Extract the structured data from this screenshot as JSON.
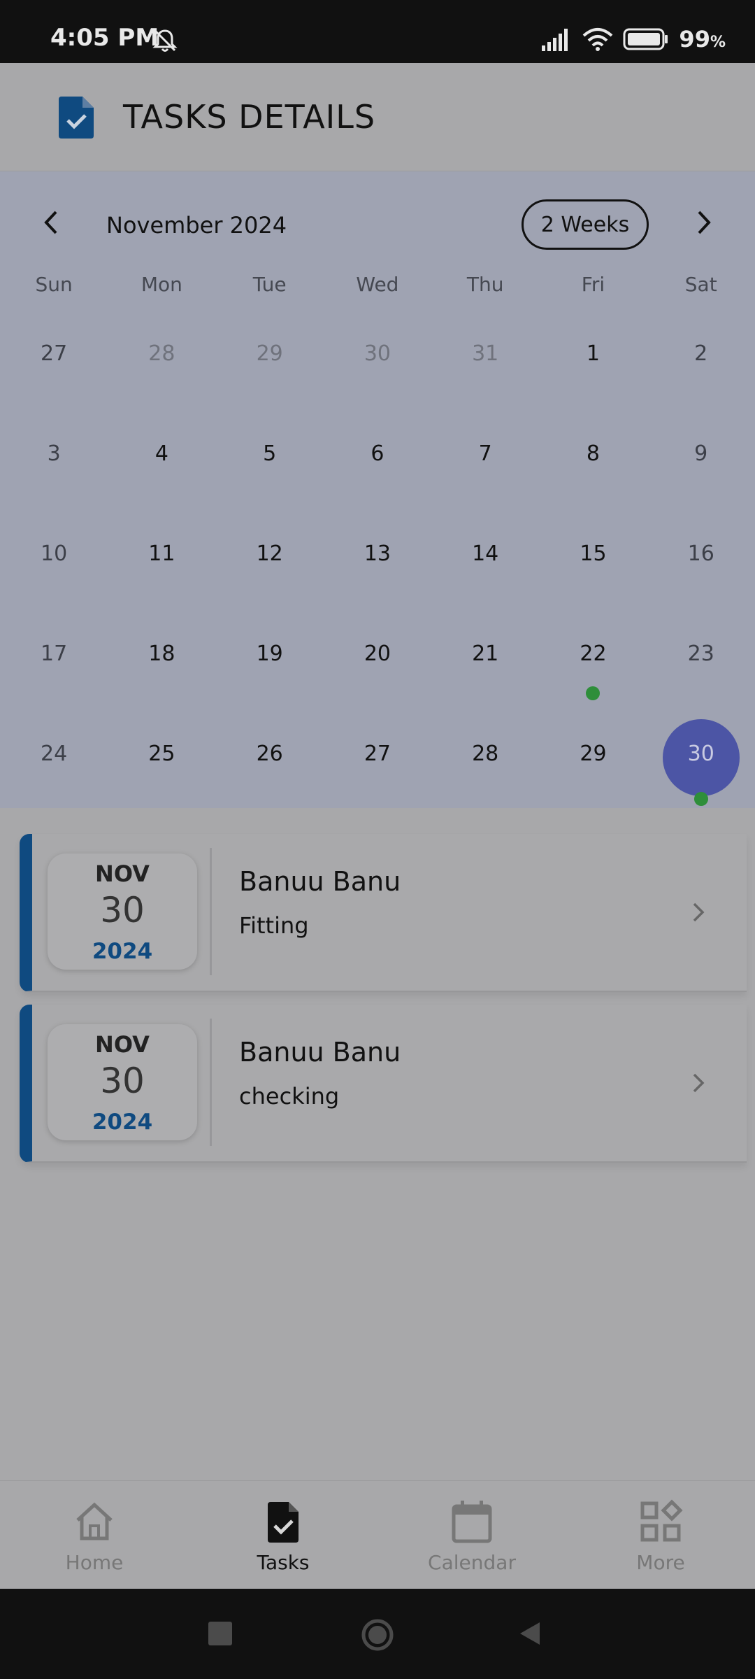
{
  "status_bar": {
    "time": "4:05 PM",
    "battery": "99",
    "battery_unit": "%"
  },
  "header": {
    "title": "TASKS DETAILS",
    "icon": "task-document-icon"
  },
  "calendar": {
    "month_label": "November 2024",
    "format_button": "2 Weeks",
    "weekdays": [
      "Sun",
      "Mon",
      "Tue",
      "Wed",
      "Thu",
      "Fri",
      "Sat"
    ],
    "weeks": [
      [
        "27",
        "28",
        "29",
        "30",
        "31",
        "1",
        "2"
      ],
      [
        "3",
        "4",
        "5",
        "6",
        "7",
        "8",
        "9"
      ],
      [
        "10",
        "11",
        "12",
        "13",
        "14",
        "15",
        "16"
      ],
      [
        "17",
        "18",
        "19",
        "20",
        "21",
        "22",
        "23"
      ],
      [
        "24",
        "25",
        "26",
        "27",
        "28",
        "29",
        "30"
      ]
    ],
    "selected_day": "30",
    "days_with_events": [
      "22",
      "30"
    ],
    "colors": {
      "selected": "#4c55a5",
      "event_dot": "#2e8e3a"
    }
  },
  "tasks": [
    {
      "month": "NOV",
      "day": "30",
      "year": "2024",
      "name": "Banuu Banu",
      "description": "Fitting"
    },
    {
      "month": "NOV",
      "day": "30",
      "year": "2024",
      "name": "Banuu Banu",
      "description": "checking"
    }
  ],
  "bottom_nav": {
    "items": [
      {
        "label": "Home",
        "icon": "home-icon"
      },
      {
        "label": "Tasks",
        "icon": "tasks-icon",
        "active": true
      },
      {
        "label": "Calendar",
        "icon": "calendar-icon"
      },
      {
        "label": "More",
        "icon": "more-grid-icon"
      }
    ]
  },
  "theme": {
    "accent": "#0f4a80"
  }
}
